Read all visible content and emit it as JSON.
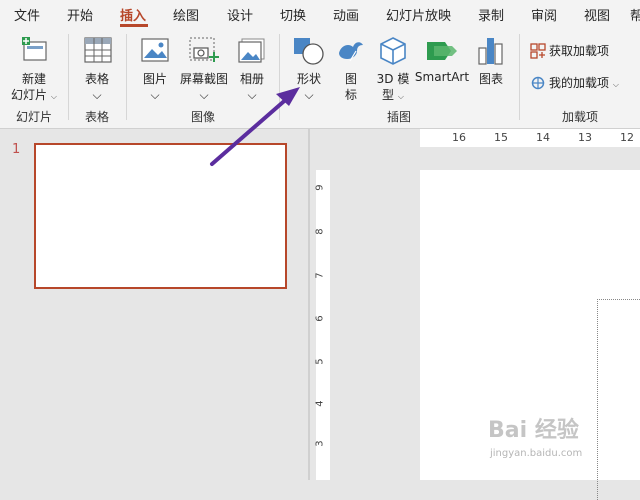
{
  "tabs": [
    "文件",
    "开始",
    "插入",
    "绘图",
    "设计",
    "切换",
    "动画",
    "幻灯片放映",
    "录制",
    "审阅",
    "视图",
    "帮"
  ],
  "active_tab": "插入",
  "ribbon": {
    "new_slide": {
      "line1": "新建",
      "line2": "幻灯片"
    },
    "table": {
      "label": "表格"
    },
    "picture": {
      "label": "图片"
    },
    "screenshot": {
      "label": "屏幕截图"
    },
    "album": {
      "label": "相册"
    },
    "shapes": {
      "label": "形状"
    },
    "icons": {
      "line1": "图",
      "line2": "标"
    },
    "model3d": {
      "line1": "3D 模",
      "line2": "型"
    },
    "smartart": {
      "label": "SmartArt"
    },
    "chart": {
      "label": "图表"
    },
    "get_addins": {
      "label": "获取加载项"
    },
    "my_addins": {
      "label": "我的加载项"
    },
    "groups": {
      "slides": "幻灯片",
      "tables": "表格",
      "images": "图像",
      "illustrations": "插图",
      "addins": "加载项"
    }
  },
  "slide_panel": {
    "number": "1"
  },
  "hruler": [
    "16",
    "15",
    "14",
    "13",
    "12"
  ],
  "vruler": [
    "9",
    "8",
    "7",
    "6",
    "5",
    "4",
    "3"
  ],
  "watermark": {
    "text": "Bai 经验",
    "sub": "jingyan.baidu.com"
  },
  "colors": {
    "accent": "#b7472a",
    "arrow": "#5b2d9e"
  }
}
